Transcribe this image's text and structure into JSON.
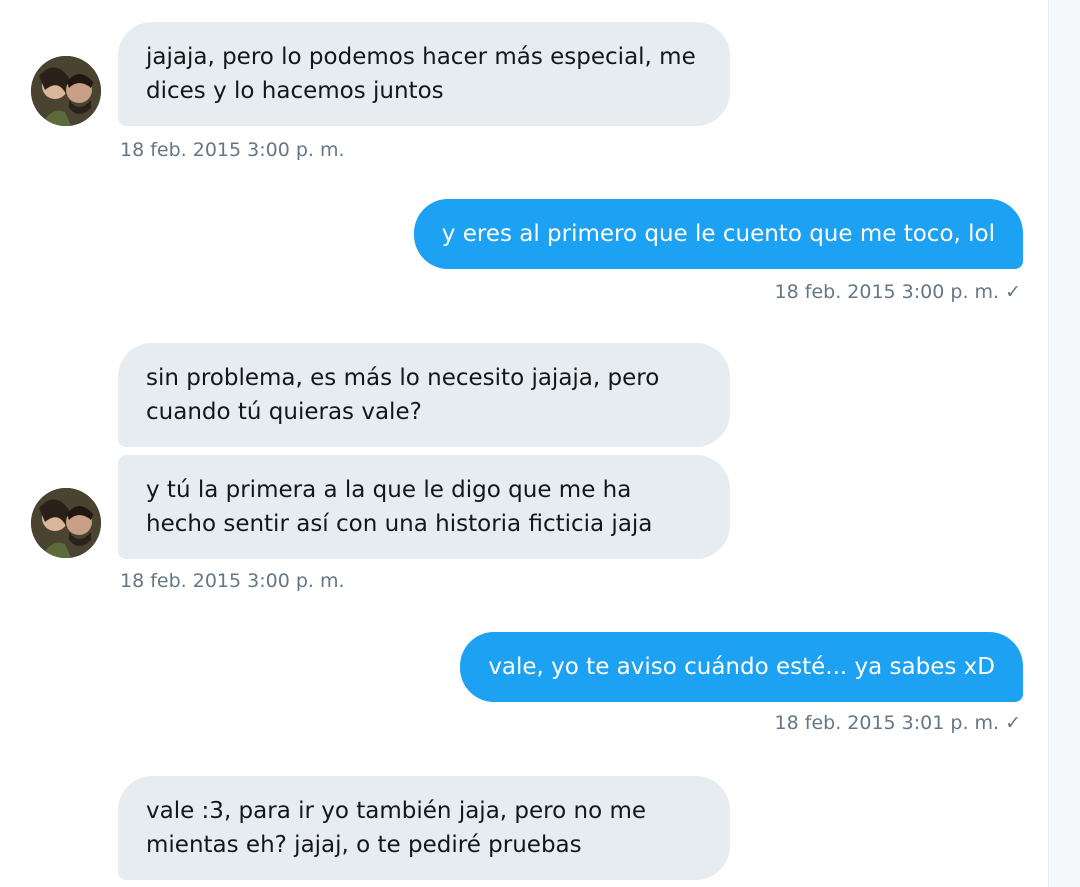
{
  "conversation": {
    "messages": [
      {
        "direction": "in",
        "text": "jajaja, pero lo podemos hacer más especial, me dices y lo hacemos juntos",
        "timestamp": "18 feb. 2015 3:00 p. m."
      },
      {
        "direction": "out",
        "text": "y eres al primero que le cuento que me toco, lol",
        "timestamp": "18 feb. 2015 3:00 p. m.",
        "read_icon": "checkmark-icon"
      },
      {
        "direction": "in",
        "text": "sin problema, es más lo necesito jajaja, pero cuando tú quieras vale?"
      },
      {
        "direction": "in",
        "text": "y tú la primera a la que le digo que me ha hecho sentir así con una historia ficticia jaja",
        "timestamp": "18 feb. 2015 3:00 p. m."
      },
      {
        "direction": "out",
        "text": "vale, yo te aviso cuándo esté... ya sabes xD",
        "timestamp": "18 feb. 2015 3:01 p. m.",
        "read_icon": "checkmark-icon"
      },
      {
        "direction": "in",
        "text": "vale :3, para ir yo también jaja, pero no me mientas eh? jajaj, o te pediré pruebas"
      }
    ],
    "check_glyph": "✓"
  },
  "colors": {
    "incoming_bubble": "#e6ecf0",
    "outgoing_bubble": "#1da1f2",
    "timestamp": "#657786"
  }
}
